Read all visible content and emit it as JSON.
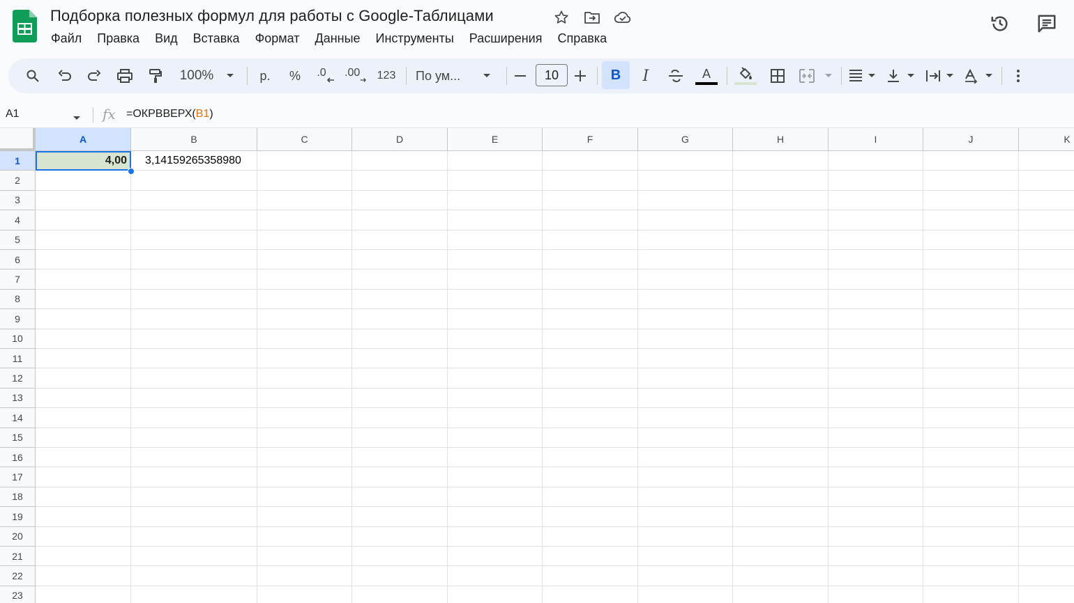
{
  "title": "Подборка полезных формул для работы с Google-Таблицами",
  "menu": [
    "Файл",
    "Правка",
    "Вид",
    "Вставка",
    "Формат",
    "Данные",
    "Инструменты",
    "Расширения",
    "Справка"
  ],
  "toolbar": {
    "zoom": "100%",
    "currency": "р.",
    "percent": "%",
    "dec_decrease": ".0",
    "dec_increase": ".00",
    "number_format": "123",
    "font_family": "По ум...",
    "font_size": "10",
    "bold": "B",
    "italic": "I",
    "text_color": "A"
  },
  "formula_bar": {
    "name_box": "A1",
    "fx": "fx",
    "formula_prefix": "=ОКРВВЕРХ(",
    "formula_ref": "B1",
    "formula_suffix": ")"
  },
  "columns": [
    "A",
    "B",
    "C",
    "D",
    "E",
    "F",
    "G",
    "H",
    "I",
    "J",
    "K"
  ],
  "rows": [
    "1",
    "2",
    "3",
    "4",
    "5",
    "6",
    "7",
    "8",
    "9",
    "10",
    "11",
    "12",
    "13",
    "14",
    "15",
    "16",
    "17",
    "18",
    "19",
    "20",
    "21",
    "22",
    "23"
  ],
  "cells": {
    "A1": "4,00",
    "B1": "3,14159265358980"
  },
  "colors": {
    "selection_blue": "#1a73e8",
    "header_selected": "#d3e3fd",
    "cell_fill": "#d7e5d0",
    "formula_ref": "#e8710a",
    "sheets_green": "#0f9d58"
  }
}
